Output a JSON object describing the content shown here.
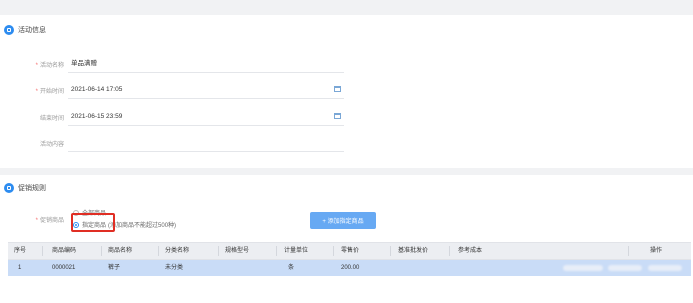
{
  "sections": {
    "activity_info": {
      "title": "活动信息"
    },
    "promo_rules": {
      "title": "促销规则"
    }
  },
  "form": {
    "activity_name": {
      "label": "活动名称",
      "value": "单品满赠",
      "required": true
    },
    "start_time": {
      "label": "开始时间",
      "value": "2021-06-14 17:05",
      "required": true,
      "icon": "calendar-icon"
    },
    "end_time": {
      "label": "结束时间",
      "value": "2021-06-15 23:59",
      "required": false,
      "icon": "calendar-icon"
    },
    "content": {
      "label": "活动内容",
      "value": ""
    }
  },
  "promo": {
    "label": "促销商品",
    "required": true,
    "options": [
      {
        "label": "全部商品",
        "checked": false
      },
      {
        "label": "指定商品",
        "checked": true
      }
    ],
    "note": "(添加商品不能超过500种)",
    "add_button": "+ 添加指定商品"
  },
  "table": {
    "columns": [
      "序号",
      "商品编码",
      "商品名称",
      "分类名称",
      "规格型号",
      "计量单位",
      "零售价",
      "基准批发价",
      "参考成本",
      "操作"
    ],
    "rows": [
      {
        "index": "1",
        "code": "0000021",
        "name": "裤子",
        "category": "未分类",
        "spec": "",
        "unit": "条",
        "retail": "200.00",
        "wholesale": "",
        "cost": ""
      }
    ]
  },
  "colors": {
    "accent": "#2d8cf0",
    "highlight": "#e02e24",
    "selected_row": "#c9dcf7",
    "button": "#67a9f3"
  }
}
